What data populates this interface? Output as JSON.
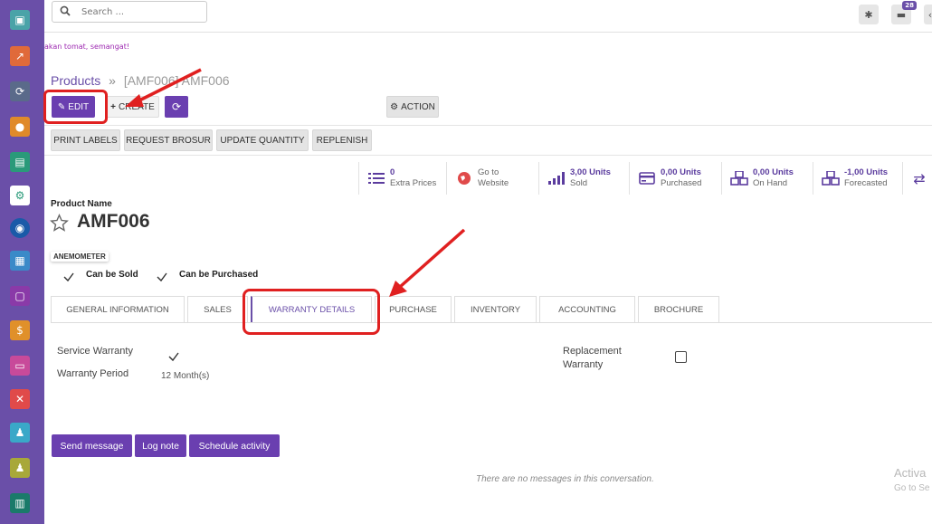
{
  "search": {
    "placeholder": "Search ..."
  },
  "topbar": {
    "bug_icon": "bug-icon",
    "chat_badge": "28",
    "chat_icon": "chat-icon"
  },
  "marquee": "akan tomat, semangat!",
  "breadcrumb": {
    "root": "Products",
    "separator": "»",
    "current": "[AMF006] AMF006"
  },
  "control": {
    "edit": "EDIT",
    "create": "CREATE",
    "action": "ACTION"
  },
  "header_buttons": [
    "PRINT LABELS",
    "REQUEST BROSUR",
    "UPDATE QUANTITY",
    "REPLENISH"
  ],
  "stats": [
    {
      "value": "0",
      "label": "Extra Prices",
      "icon": "list-icon"
    },
    {
      "value": "Go to",
      "label": "Website",
      "icon": "globe-icon"
    },
    {
      "value": "3,00 Units",
      "label": "Sold",
      "icon": "signal-icon"
    },
    {
      "value": "0,00 Units",
      "label": "Purchased",
      "icon": "credit-card-icon"
    },
    {
      "value": "0,00 Units",
      "label": "On Hand",
      "icon": "cubes-icon"
    },
    {
      "value": "-1,00 Units",
      "label": "Forecasted",
      "icon": "cubes-icon"
    }
  ],
  "product": {
    "name_label": "Product Name",
    "name": "AMF006",
    "tag": "ANEMOMETER",
    "can_be_sold": "Can be Sold",
    "can_be_purchased": "Can be Purchased"
  },
  "tabs": [
    "GENERAL INFORMATION",
    "SALES",
    "WARRANTY DETAILS",
    "PURCHASE",
    "INVENTORY",
    "ACCOUNTING",
    "BROCHURE"
  ],
  "active_tab": "WARRANTY DETAILS",
  "warranty": {
    "service_warranty_label": "Service Warranty",
    "warranty_period_label": "Warranty Period",
    "warranty_period_value": "12",
    "warranty_period_unit": "Month(s)",
    "replacement_label_1": "Replacement",
    "replacement_label_2": "Warranty"
  },
  "chatter": {
    "send_message": "Send message",
    "log_note": "Log note",
    "schedule_activity": "Schedule activity",
    "empty": "There are no messages in this conversation."
  },
  "watermark": {
    "line1": "Activa",
    "line2": "Go to Se"
  },
  "colors": {
    "sidebar": "#6a4fa8",
    "primary": "#6a3fb0",
    "highlight": "#e02020"
  }
}
